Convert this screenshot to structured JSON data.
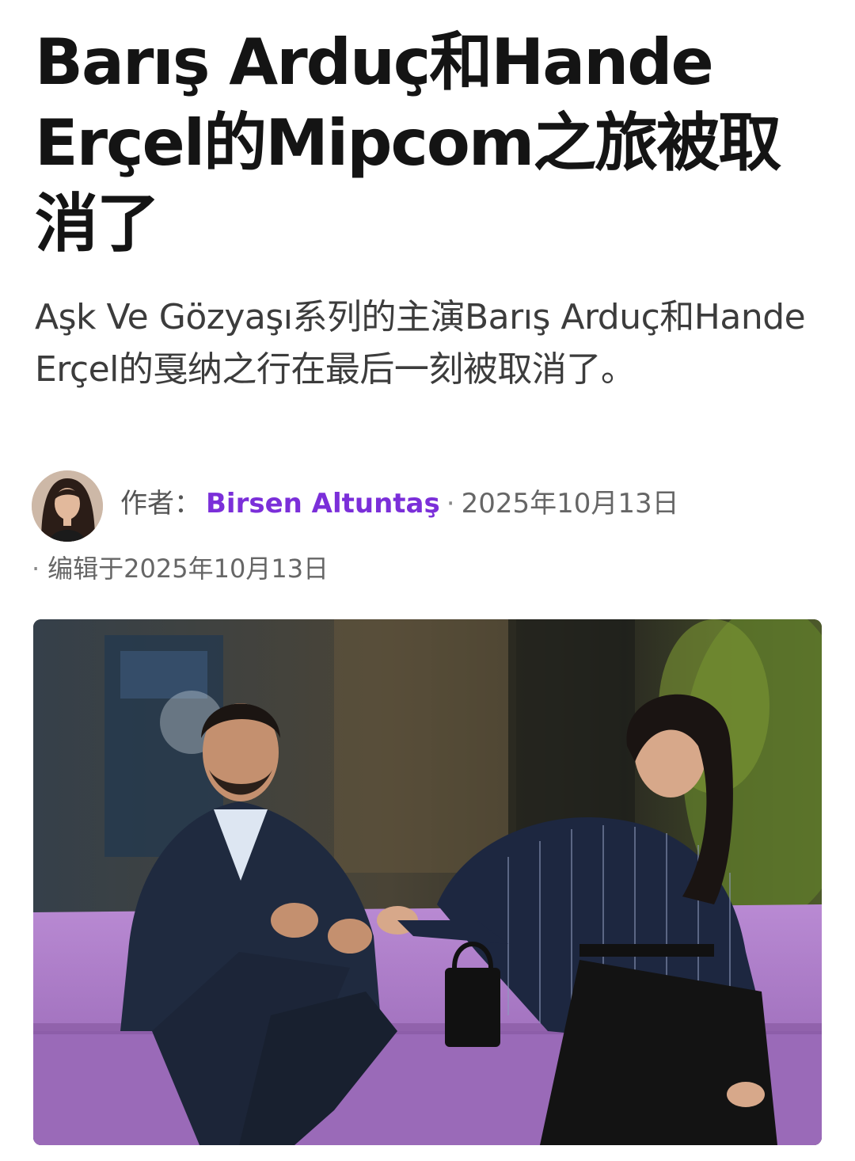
{
  "article": {
    "headline": "Barış Arduç和Hande Erçel的Mipcom之旅被取消了",
    "dek": "Aşk Ve Gözyaşı系列的主演Barış Arduç和Hande Erçel的戛纳之行在最后一刻被取消了。",
    "byline": {
      "label": "作者：",
      "author": "Birsen Altuntaş",
      "separator": "·",
      "date": "2025年10月13日"
    },
    "edited": {
      "separator": "·",
      "text": "编辑于2025年10月13日"
    }
  },
  "colors": {
    "author_link": "#7b2fd9",
    "sofa": "#a677c4"
  },
  "icons": {
    "avatar": "author-avatar",
    "photo": "article-photo"
  }
}
